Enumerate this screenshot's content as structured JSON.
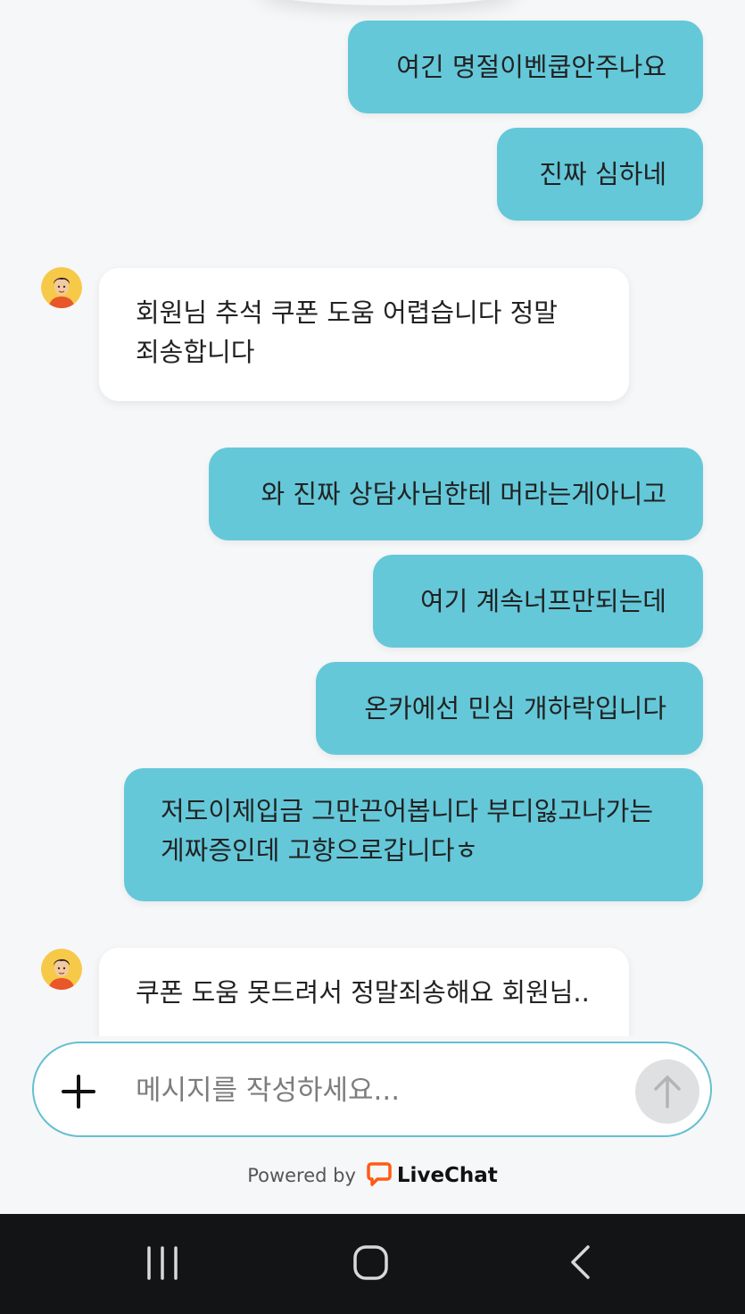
{
  "messages": [
    {
      "from": "user",
      "text": "여긴 명절이벤쿱안주나요"
    },
    {
      "from": "user",
      "text": "진짜 심하네"
    },
    {
      "from": "agent",
      "text": "회원님 추석 쿠폰 도움 어렵습니다 정말 죄송합니다"
    },
    {
      "from": "user",
      "text": "와 진짜 상담사님한테 머라는게아니고"
    },
    {
      "from": "user",
      "text": "여기 계속너프만되는데"
    },
    {
      "from": "user",
      "text": "온카에선 민심 개하락입니다"
    },
    {
      "from": "user",
      "text": "저도이제입금 그만끈어봅니다 부디잃고나가는게짜증인데 고향으로갑니다ㅎ"
    },
    {
      "from": "agent",
      "text": "쿠폰 도움 못드려서 정말죄송해요 회원님.."
    }
  ],
  "composer": {
    "placeholder": "메시지를 작성하세요...",
    "value": ""
  },
  "footer": {
    "powered_by": "Powered by",
    "brand": "LiveChat"
  },
  "icons": {
    "attach": "plus-icon",
    "send": "arrow-up-icon",
    "brand_logo": "livechat-logo",
    "nav_recents": "recent-apps-icon",
    "nav_home": "home-icon",
    "nav_back": "back-icon"
  },
  "colors": {
    "user_bubble": "#64c8d9",
    "agent_bubble": "#ffffff",
    "background": "#f6f7f8",
    "composer_border": "#64c0cf",
    "brand_orange": "#ff5a14",
    "navbar": "#131416"
  }
}
